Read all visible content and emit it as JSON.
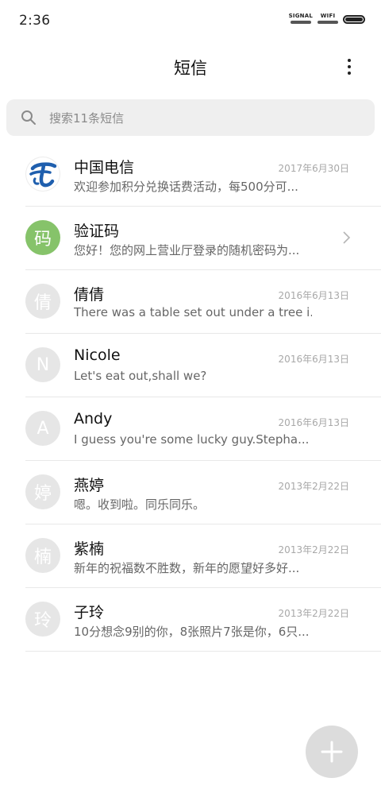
{
  "status_bar": {
    "time": "2:36",
    "signal_label": "SIGNAL",
    "wifi_label": "WIFI"
  },
  "header": {
    "title": "短信",
    "more_icon": "more-vertical-icon"
  },
  "search": {
    "placeholder": "搜索11条短信",
    "icon": "search-icon"
  },
  "conversations": [
    {
      "name": "中国电信",
      "preview": "欢迎参加积分兑换话费活动，每500分可...",
      "date": "2017年6月30日",
      "avatar_text": "",
      "avatar_type": "logo"
    },
    {
      "name": "验证码",
      "preview": "您好！您的网上营业厅登录的随机密码为...",
      "date": "",
      "avatar_text": "码",
      "avatar_type": "green"
    },
    {
      "name": "倩倩",
      "preview": "There was a table set out under a tree i...",
      "date": "2016年6月13日",
      "avatar_text": "倩",
      "avatar_type": "gray"
    },
    {
      "name": "Nicole",
      "preview": "Let's eat out,shall we?",
      "date": "2016年6月13日",
      "avatar_text": "N",
      "avatar_type": "gray"
    },
    {
      "name": "Andy",
      "preview": "I guess you're some lucky guy.Stepha...",
      "date": "2016年6月13日",
      "avatar_text": "A",
      "avatar_type": "gray"
    },
    {
      "name": "燕婷",
      "preview": "嗯。收到啦。同乐同乐。",
      "date": "2013年2月22日",
      "avatar_text": "婷",
      "avatar_type": "gray"
    },
    {
      "name": "紫楠",
      "preview": "新年的祝福数不胜数，新年的愿望好多好...",
      "date": "2013年2月22日",
      "avatar_text": "楠",
      "avatar_type": "gray"
    },
    {
      "name": "子玲",
      "preview": "10分想念9别的你，8张照片7张是你，6只...",
      "date": "2013年2月22日",
      "avatar_text": "玲",
      "avatar_type": "gray"
    }
  ],
  "colors": {
    "accent_green": "#86c36a",
    "avatar_gray": "#e6e6e6",
    "search_bg": "#efefef",
    "fab_bg": "#dcdcdc",
    "logo_blue": "#1f5fae"
  },
  "fab": {
    "icon": "plus-icon"
  }
}
